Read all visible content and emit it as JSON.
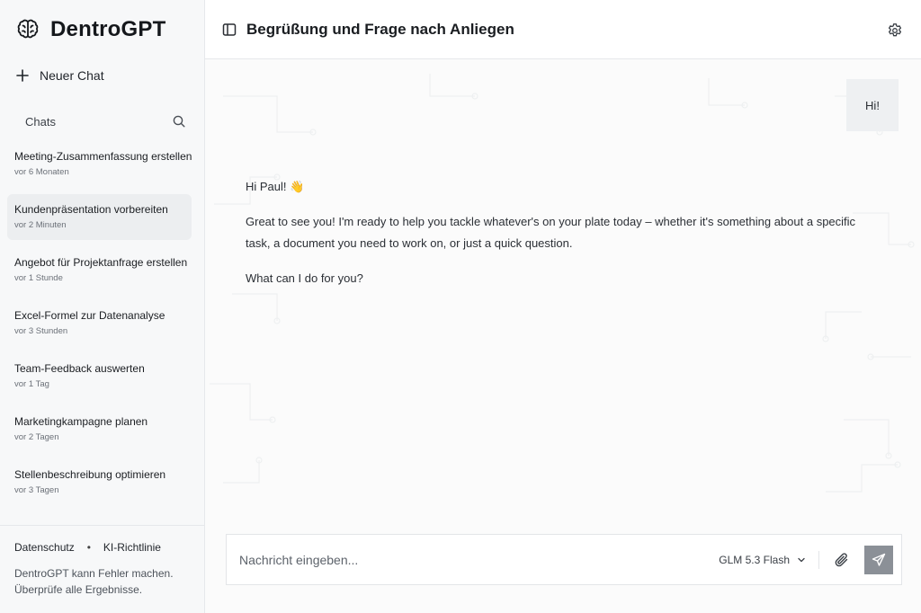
{
  "brand": {
    "name": "DentroGPT",
    "icon": "brain-icon"
  },
  "sidebar": {
    "new_chat_label": "Neuer Chat",
    "chats_label": "Chats",
    "items": [
      {
        "title": "Meeting-Zusammenfassung erstellen",
        "time": "vor 6 Monaten",
        "active": false
      },
      {
        "title": "Kundenpräsentation vorbereiten",
        "time": "vor 2 Minuten",
        "active": true
      },
      {
        "title": "Angebot für Projektanfrage erstellen",
        "time": "vor 1 Stunde",
        "active": false
      },
      {
        "title": "Excel-Formel zur Datenanalyse",
        "time": "vor 3 Stunden",
        "active": false
      },
      {
        "title": "Team-Feedback auswerten",
        "time": "vor 1 Tag",
        "active": false
      },
      {
        "title": "Marketingkampagne planen",
        "time": "vor 2 Tagen",
        "active": false
      },
      {
        "title": "Stellenbeschreibung optimieren",
        "time": "vor 3 Tagen",
        "active": false
      }
    ],
    "footer": {
      "privacy_link": "Datenschutz",
      "separator": "•",
      "ai_policy_link": "KI-Richtlinie",
      "disclaimer_line1": "DentroGPT kann Fehler machen.",
      "disclaimer_line2": "Überprüfe alle Ergebnisse."
    }
  },
  "header": {
    "title": "Begrüßung und Frage nach Anliegen"
  },
  "conversation": {
    "user_message": "Hi!",
    "assistant": {
      "greeting": "Hi Paul! 👋",
      "body": "Great to see you! I'm ready to help you tackle whatever's on your plate today – whether it's something about a specific task, a document you need to work on, or just a quick question.",
      "question": "What can I do for you?"
    }
  },
  "composer": {
    "placeholder": "Nachricht eingeben...",
    "model": "GLM 5.3 Flash"
  },
  "colors": {
    "sidebar_bg": "#f7f8f9",
    "active_item_bg": "#eceef0",
    "user_bubble_bg": "#eef0f2",
    "send_button_bg": "#8b9097"
  }
}
